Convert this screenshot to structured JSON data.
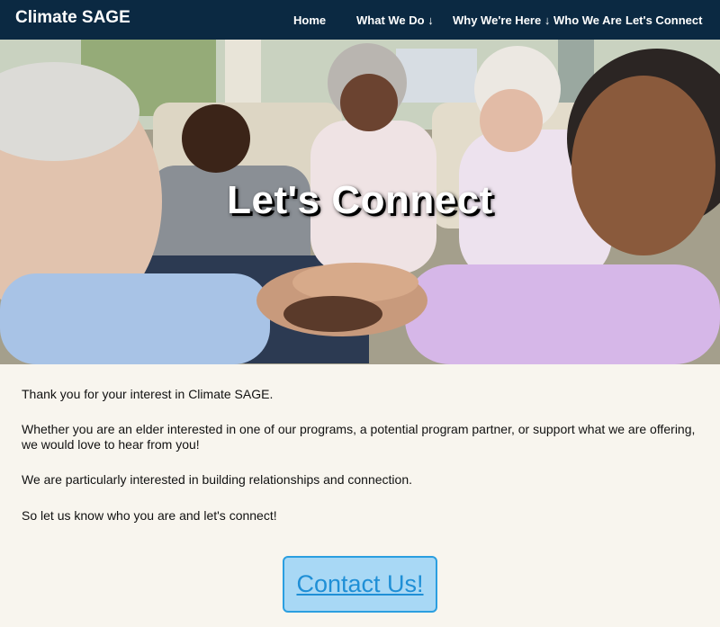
{
  "brand": "Climate SAGE",
  "nav": [
    {
      "label": "Home"
    },
    {
      "label": "What We Do ↓"
    },
    {
      "label": "Why We're Here ↓"
    },
    {
      "label": "Who We Are"
    },
    {
      "label": "Let's Connect"
    }
  ],
  "hero": {
    "title": "Let's Connect"
  },
  "content": {
    "paragraphs": [
      "Thank you for your interest in Climate SAGE.",
      "Whether you are an elder interested in one of our programs, a potential program partner, or support what we are offering, we would love to hear from you!",
      "We are particularly interested in building relationships and connection.",
      "So let us know who you are and let's connect!"
    ]
  },
  "cta": {
    "label": "Contact Us!"
  },
  "colors": {
    "nav_bg": "#0b2942",
    "page_bg": "#f8f5ee",
    "button_bg": "#a8d8f5",
    "button_border": "#2b9fe0",
    "button_text": "#1f8fd6"
  }
}
